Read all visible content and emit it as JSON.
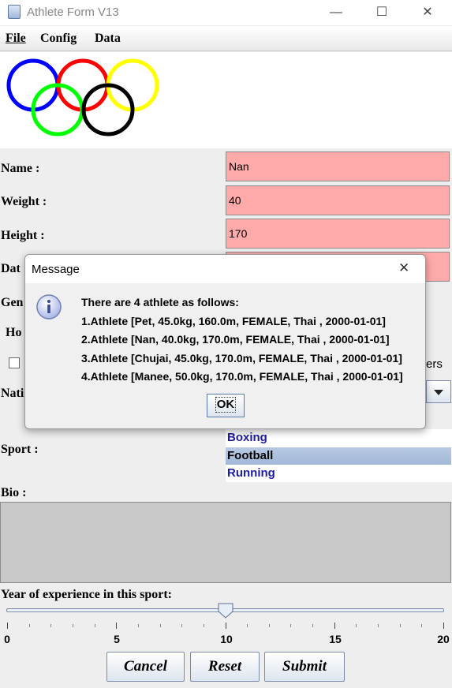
{
  "window": {
    "title": "Athlete Form V13",
    "minimize_glyph": "—",
    "maximize_glyph": "☐",
    "close_glyph": "✕"
  },
  "menu": {
    "items": [
      "File",
      "Config",
      "Data"
    ]
  },
  "logo": {
    "ring_colors": [
      "#0000ff",
      "#ff0000",
      "#ffff00",
      "#00ff00",
      "#000000"
    ]
  },
  "form": {
    "name_label": "Name :",
    "name_value": "Nan",
    "weight_label": "Weight :",
    "weight_value": "40",
    "height_label": "Height :",
    "height_value": "170",
    "date_label_partial": "Dat",
    "gender_label_partial": "Gen",
    "hobbies_label_partial": "Ho",
    "hobby_option_partial": "ers",
    "nationality_label_partial": "Nati",
    "sport_label": "Sport :",
    "sports": [
      {
        "label": "Boxing",
        "selected": false
      },
      {
        "label": "Football",
        "selected": true
      },
      {
        "label": "Running",
        "selected": false
      }
    ],
    "bio_label": "Bio :",
    "experience_label": "Year of experience in this sport:",
    "experience_value": 10,
    "experience_min": 0,
    "experience_max": 20,
    "slider_ticks": [
      "0",
      "5",
      "10",
      "15",
      "20"
    ]
  },
  "buttons": {
    "cancel": "Cancel",
    "reset": "Reset",
    "submit": "Submit"
  },
  "dialog": {
    "title": "Message",
    "close_glyph": "✕",
    "icon": "info-icon",
    "lines": [
      "There are 4 athlete as follows:",
      "1.Athlete [Pet, 45.0kg, 160.0m, FEMALE, Thai , 2000-01-01]",
      "2.Athlete [Nan, 40.0kg, 170.0m, FEMALE, Thai , 2000-01-01]",
      "3.Athlete [Chujai, 45.0kg, 170.0m, FEMALE, Thai , 2000-01-01]",
      "4.Athlete [Manee, 50.0kg, 170.0m, FEMALE, Thai , 2000-01-01]"
    ],
    "ok_label": "OK"
  },
  "colors": {
    "field_bg": "#ffaaaa",
    "list_selected": "#a8bcd9",
    "list_text": "#1c1ca0"
  }
}
